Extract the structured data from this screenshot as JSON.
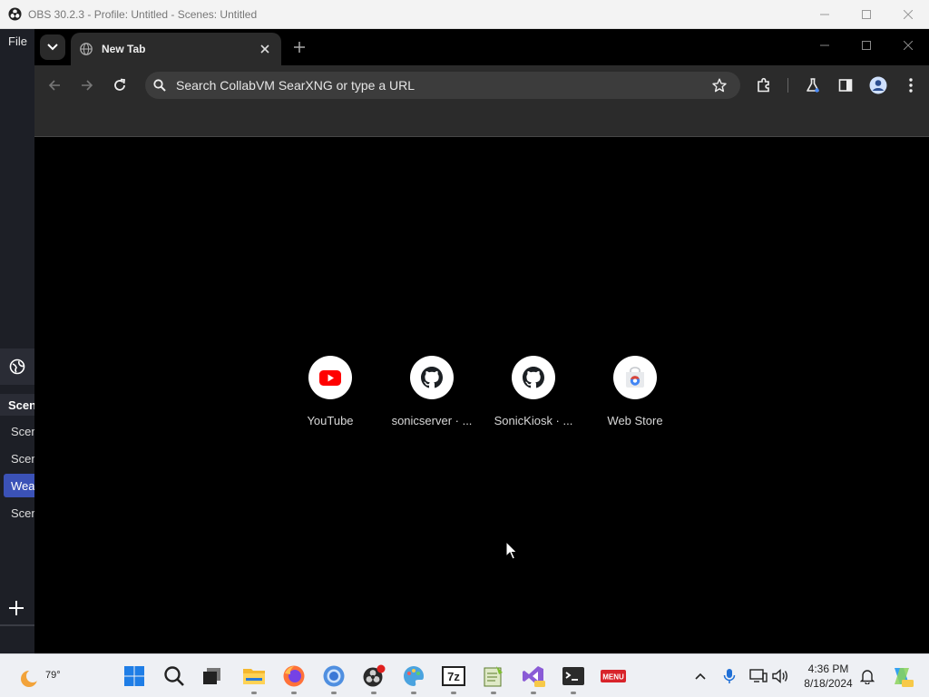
{
  "obs": {
    "title": "OBS 30.2.3 - Profile: Untitled - Scenes: Untitled",
    "menu_file": "File",
    "scenes_header": "Scen",
    "scenes": [
      {
        "label": "Scen",
        "active": false
      },
      {
        "label": "Scen",
        "active": false
      },
      {
        "label": "Wea",
        "active": true
      },
      {
        "label": "Scen",
        "active": false
      }
    ],
    "add_label": "+"
  },
  "browser": {
    "tab_title": "New Tab",
    "omnibox_placeholder": "Search CollabVM SearXNG or type a URL",
    "shortcuts": [
      {
        "label": "YouTube",
        "icon": "youtube-icon"
      },
      {
        "label": "sonicserver · ...",
        "icon": "github-icon"
      },
      {
        "label": "SonicKiosk · ...",
        "icon": "github-icon"
      },
      {
        "label": "Web Store",
        "icon": "web-store-icon"
      }
    ]
  },
  "taskbar": {
    "weather_temp": "79°",
    "time": "4:36 PM",
    "date": "8/18/2024",
    "apps": [
      "start-icon",
      "search-icon",
      "task-view-icon",
      "file-explorer-icon",
      "firefox-icon",
      "chrome-icon",
      "obs-icon",
      "paint-icon",
      "7zip-icon",
      "notepad-plus-icon",
      "visual-studio-icon",
      "terminal-icon",
      "menu-app-icon"
    ],
    "menu_app_text": "MENU"
  },
  "colors": {
    "obs_scene_active": "#3b52b7",
    "chrome_toolbar": "#2b2b2b",
    "youtube_red": "#ff0000"
  }
}
